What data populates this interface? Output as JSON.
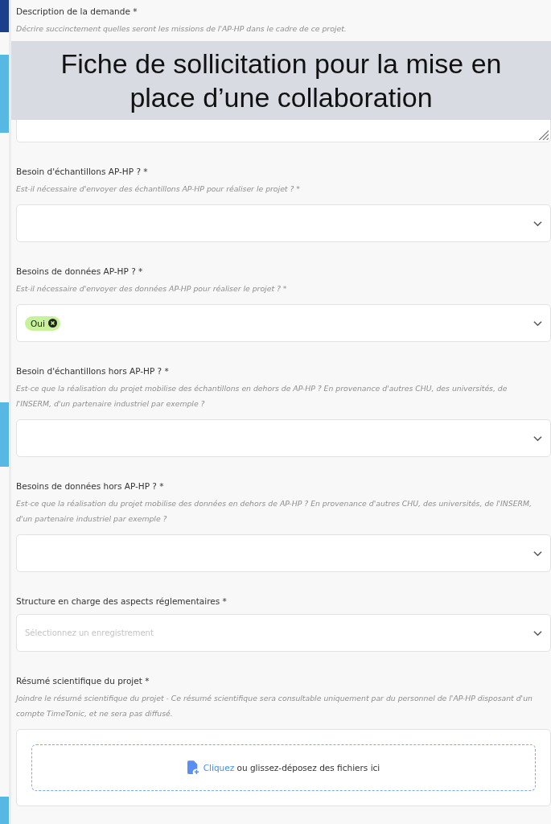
{
  "overlay_title": "Fiche de sollicitation pour la mise en place d’une collaboration",
  "fields": [
    {
      "kind": "textarea",
      "label": "Description de la demande *",
      "hint": "Décrire succinctement quelles seront les missions de l'AP-HP dans le cadre de ce projet."
    },
    {
      "kind": "select",
      "label": "Besoin d'échantillons AP-HP ? *",
      "hint": "Est-il nécessaire d'envoyer des échantillons AP-HP pour réaliser le projet ? *"
    },
    {
      "kind": "select",
      "label": "Besoins de données AP-HP ? *",
      "hint": "Est-il nécessaire d'envoyer des données AP-HP pour réaliser le projet ? *",
      "chips": [
        "Oui"
      ]
    },
    {
      "kind": "select",
      "label": "Besoin d'échantillons hors AP-HP ? *",
      "hint": "Est-ce que la réalisation du projet mobilise des échantillons en dehors de AP-HP ? En provenance d'autres CHU, des universités, de l'INSERM, d'un partenaire industriel par exemple ?"
    },
    {
      "kind": "select",
      "label": "Besoins de données hors AP-HP ? *",
      "hint": "Est-ce que la réalisation du projet mobilise des données en dehors de AP-HP ? En provenance d'autres CHU, des universités, de l'INSERM, d'un partenaire industriel par exemple ?"
    },
    {
      "kind": "select",
      "label": "Structure en charge des aspects réglementaires *",
      "placeholder": "Sélectionnez un enregistrement"
    },
    {
      "kind": "upload",
      "label": "Résumé scientifique du projet *",
      "hint": "Joindre le résumé scientifique du projet - Ce résumé scientifique sera consultable uniquement par du personnel de l'AP-HP disposant d'un compte TimeTonic, et ne sera pas diffusé.",
      "link": "Cliquez",
      "text": "ou glissez-déposez des fichiers ici"
    }
  ]
}
